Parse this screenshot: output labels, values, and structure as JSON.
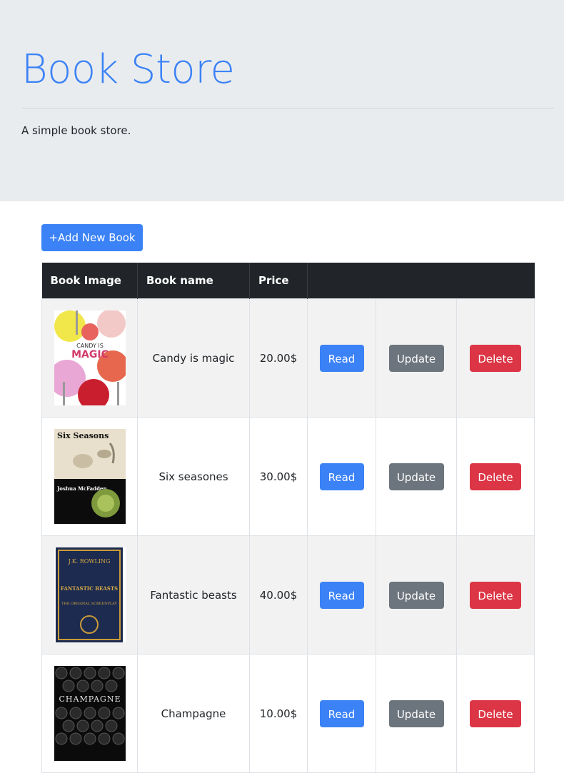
{
  "header": {
    "title": "Book Store",
    "subtitle": "A simple book store."
  },
  "toolbar": {
    "add_label": "+Add New Book"
  },
  "table": {
    "columns": [
      "Book Image",
      "Book name",
      "Price",
      ""
    ],
    "rows": [
      {
        "name": "Candy is magic",
        "price": "20.00$",
        "cover": "candy-cover",
        "cover_text": [
          "CANDY IS",
          "MAGIC"
        ]
      },
      {
        "name": "Six seasones",
        "price": "30.00$",
        "cover": "six-seasons-cover",
        "cover_text": [
          "Six Seasons",
          "Joshua McFadden"
        ]
      },
      {
        "name": "Fantastic beasts",
        "price": "40.00$",
        "cover": "fantastic-beasts-cover",
        "cover_text": [
          "J.K. ROWLING",
          "FANTASTIC BEASTS",
          "THE ORIGINAL SCREENPLAY"
        ]
      },
      {
        "name": "Champagne",
        "price": "10.00$",
        "cover": "champagne-cover",
        "cover_text": [
          "CHAMPAGNE"
        ]
      }
    ],
    "actions": {
      "read": "Read",
      "update": "Update",
      "delete": "Delete"
    }
  },
  "colors": {
    "primary": "#3b82f6",
    "secondary": "#6c757d",
    "danger": "#dc3545",
    "dark": "#212529",
    "jumbotron": "#e9ecef"
  }
}
